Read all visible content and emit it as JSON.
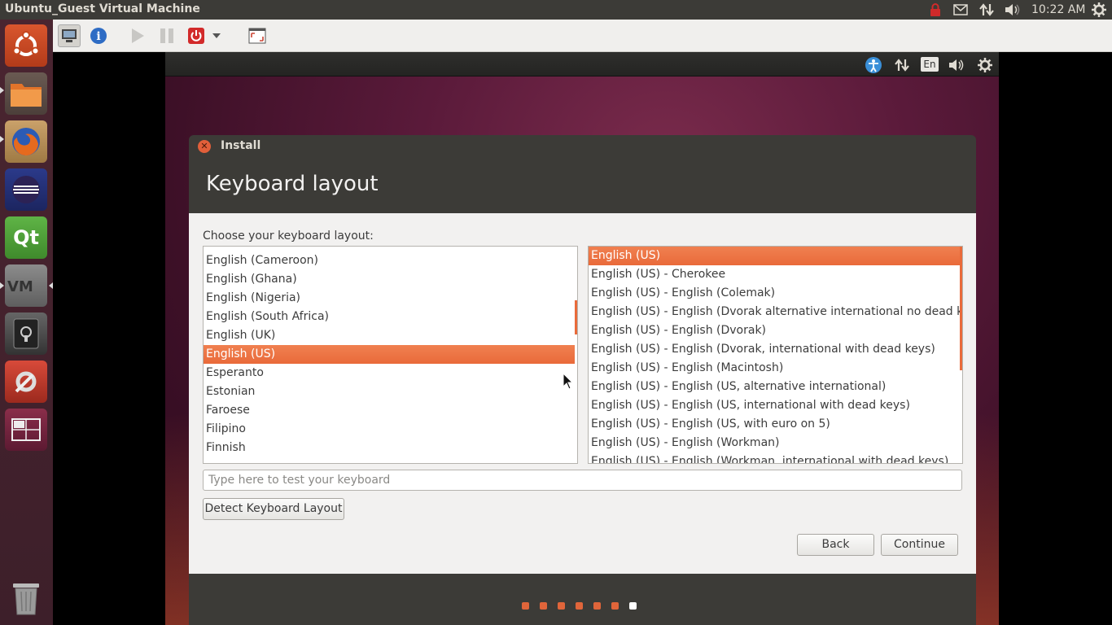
{
  "host_panel": {
    "title": "Ubuntu_Guest Virtual Machine",
    "clock": "10:22 AM",
    "indicators": [
      "lock-icon",
      "mail-icon",
      "network-icon",
      "volume-icon",
      "settings-gear-icon"
    ]
  },
  "launcher": {
    "items": [
      "ubuntu-dash-icon",
      "files-icon",
      "firefox-icon",
      "eclipse-icon",
      "qt-creator-icon",
      "vmware-icon",
      "safe-icon",
      "system-settings-icon",
      "workspace-switcher-icon",
      "trash-icon"
    ]
  },
  "vm_toolbar": {
    "buttons": [
      "display-icon",
      "info-icon",
      "play-icon",
      "pause-icon",
      "power-icon",
      "dropdown-arrow-icon",
      "fullscreen-icon"
    ]
  },
  "guest_panel": {
    "lang_indicator": "En",
    "indicators": [
      "accessibility-icon",
      "network-icon",
      "language-indicator",
      "volume-icon",
      "settings-gear-icon"
    ]
  },
  "dialog": {
    "window_title": "Install",
    "heading": "Keyboard layout",
    "choose_label": "Choose your keyboard layout:",
    "left_list": [
      "English (Cameroon)",
      "English (Ghana)",
      "English (Nigeria)",
      "English (South Africa)",
      "English (UK)",
      "English (US)",
      "Esperanto",
      "Estonian",
      "Faroese",
      "Filipino",
      "Finnish"
    ],
    "left_selected": "English (US)",
    "right_list": [
      "English (US)",
      "English (US) - Cherokee",
      "English (US) - English (Colemak)",
      "English (US) - English (Dvorak alternative international no dead keys)",
      "English (US) - English (Dvorak)",
      "English (US) - English (Dvorak, international with dead keys)",
      "English (US) - English (Macintosh)",
      "English (US) - English (US, alternative international)",
      "English (US) - English (US, international with dead keys)",
      "English (US) - English (US, with euro on 5)",
      "English (US) - English (Workman)",
      "English (US) - English (Workman, international with dead keys)"
    ],
    "right_selected": "English (US)",
    "test_input": {
      "value": "",
      "placeholder": "Type here to test your keyboard"
    },
    "detect_button": "Detect Keyboard Layout",
    "back_button": "Back",
    "continue_button": "Continue",
    "progress": {
      "total_steps": 7,
      "current_step": 7
    }
  },
  "colors": {
    "accent": "#e96a3a",
    "panel": "#3c3b37",
    "dialog_body": "#f2f1f0",
    "dot_done": "#e0653a",
    "dot_current": "#ffffff"
  }
}
